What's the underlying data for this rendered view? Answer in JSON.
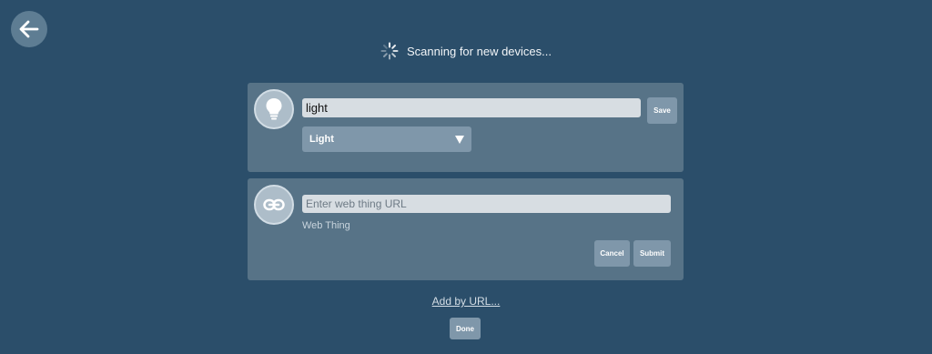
{
  "header": {
    "back_icon": "arrow-left-icon"
  },
  "scan": {
    "status": "Scanning for new devices...",
    "icon": "spinner-icon"
  },
  "device": {
    "icon": "lightbulb-icon",
    "name_value": "light",
    "save_label": "Save",
    "type_selected": "Light"
  },
  "url_form": {
    "icon": "link-icon",
    "placeholder": "Enter web thing URL",
    "label": "Web Thing",
    "cancel_label": "Cancel",
    "submit_label": "Submit"
  },
  "footer": {
    "add_by_url": "Add by URL...",
    "done_label": "Done"
  },
  "colors": {
    "background": "#2b4e6a",
    "card": "#577387",
    "button": "#7f97aa"
  }
}
